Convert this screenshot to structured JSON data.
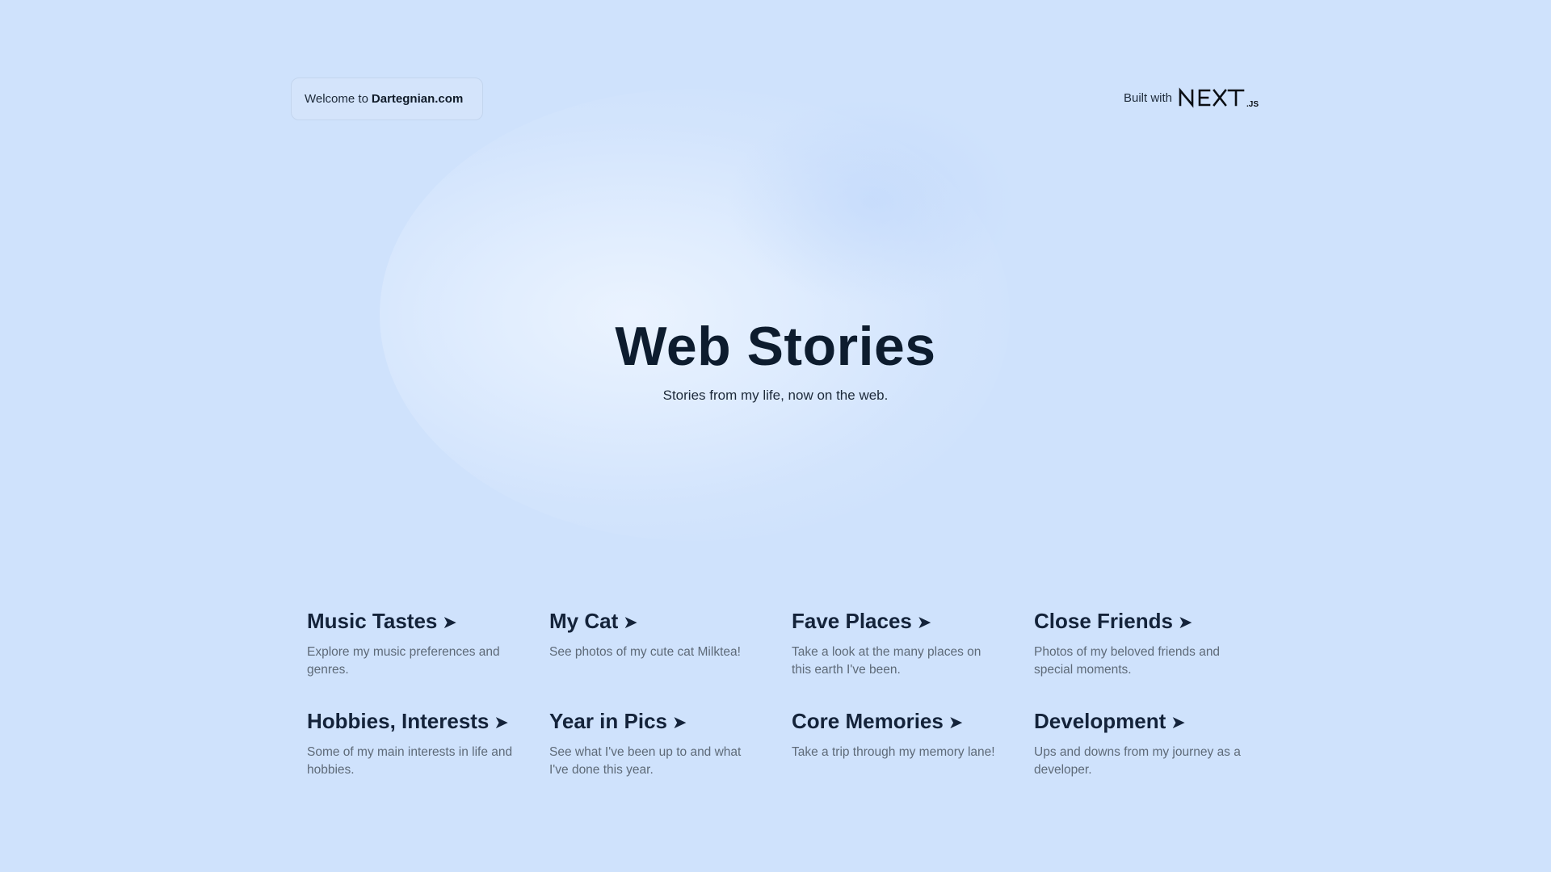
{
  "header": {
    "welcome_prefix": "Welcome to",
    "welcome_site": "Dartegnian.com",
    "built_with_label": "Built with",
    "framework_logo_text": "NEXT.JS"
  },
  "hero": {
    "title": "Web Stories",
    "subtitle": "Stories from my life, now on the web."
  },
  "cards": [
    {
      "title": "Music Tastes",
      "arrow": "➤",
      "description": "Explore my music preferences and genres."
    },
    {
      "title": "My Cat",
      "arrow": "➤",
      "description": "See photos of my cute cat Milktea!"
    },
    {
      "title": "Fave Places",
      "arrow": "➤",
      "description": "Take a look at the many places on this earth I've been."
    },
    {
      "title": "Close Friends",
      "arrow": "➤",
      "description": "Photos of my beloved friends and special moments."
    },
    {
      "title": "Hobbies, Interests",
      "arrow": "➤",
      "description": "Some of my main interests in life and hobbies."
    },
    {
      "title": "Year in Pics",
      "arrow": "➤",
      "description": "See what I've been up to and what I've done this year."
    },
    {
      "title": "Core Memories",
      "arrow": "➤",
      "description": "Take a trip through my memory lane!"
    },
    {
      "title": "Development",
      "arrow": "➤",
      "description": "Ups and downs from my journey as a developer."
    }
  ],
  "colors": {
    "background": "#cfe2fc",
    "title_text": "#0d1c2e",
    "muted_text": "#5e6a78"
  }
}
